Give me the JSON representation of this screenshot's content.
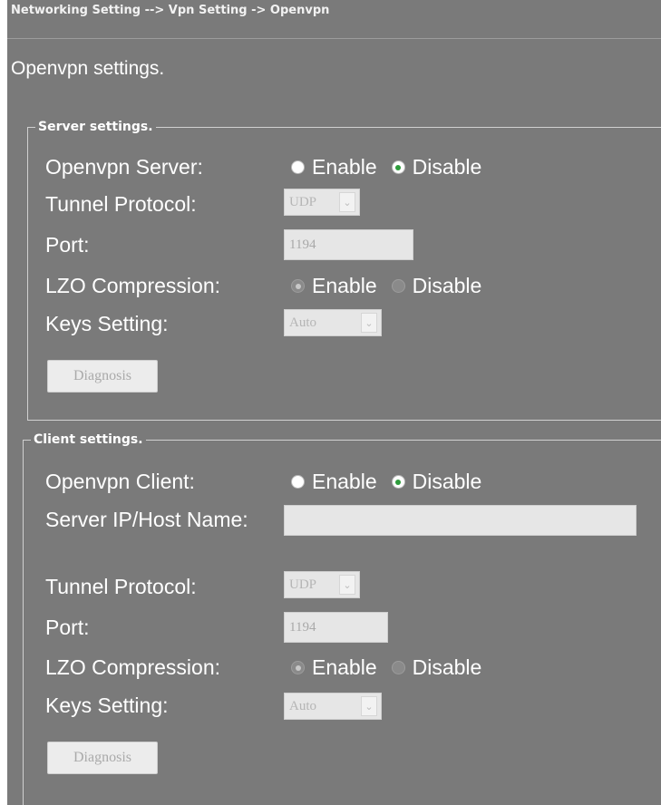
{
  "breadcrumb": "Networking Setting --> Vpn Setting -> Openvpn",
  "page_title": "Openvpn settings.",
  "server": {
    "legend": "Server settings.",
    "openvpn_label": "Openvpn Server:",
    "openvpn_options": [
      "Enable",
      "Disable"
    ],
    "openvpn_selected": "Disable",
    "protocol_label": "Tunnel Protocol:",
    "protocol_value": "UDP",
    "port_label": "Port:",
    "port_value": "1194",
    "lzo_label": "LZO Compression:",
    "lzo_options": [
      "Enable",
      "Disable"
    ],
    "lzo_selected": "Enable",
    "keys_label": "Keys Setting:",
    "keys_value": "Auto",
    "diagnosis_label": "Diagnosis"
  },
  "client": {
    "legend": "Client settings.",
    "openvpn_label": "Openvpn Client:",
    "openvpn_options": [
      "Enable",
      "Disable"
    ],
    "openvpn_selected": "Disable",
    "host_label": "Server IP/Host Name:",
    "host_value": "",
    "protocol_label": "Tunnel Protocol:",
    "protocol_value": "UDP",
    "port_label": "Port:",
    "port_value": "1194",
    "lzo_label": "LZO Compression:",
    "lzo_options": [
      "Enable",
      "Disable"
    ],
    "lzo_selected": "Enable",
    "keys_label": "Keys Setting:",
    "keys_value": "Auto",
    "diagnosis_label": "Diagnosis"
  },
  "colors": {
    "panel_bg": "#7a7a7a",
    "radio_check": "#2e9c3c",
    "disabled_field": "#e6e6e6"
  },
  "icons": {
    "dropdown": "chevron-down-icon"
  }
}
